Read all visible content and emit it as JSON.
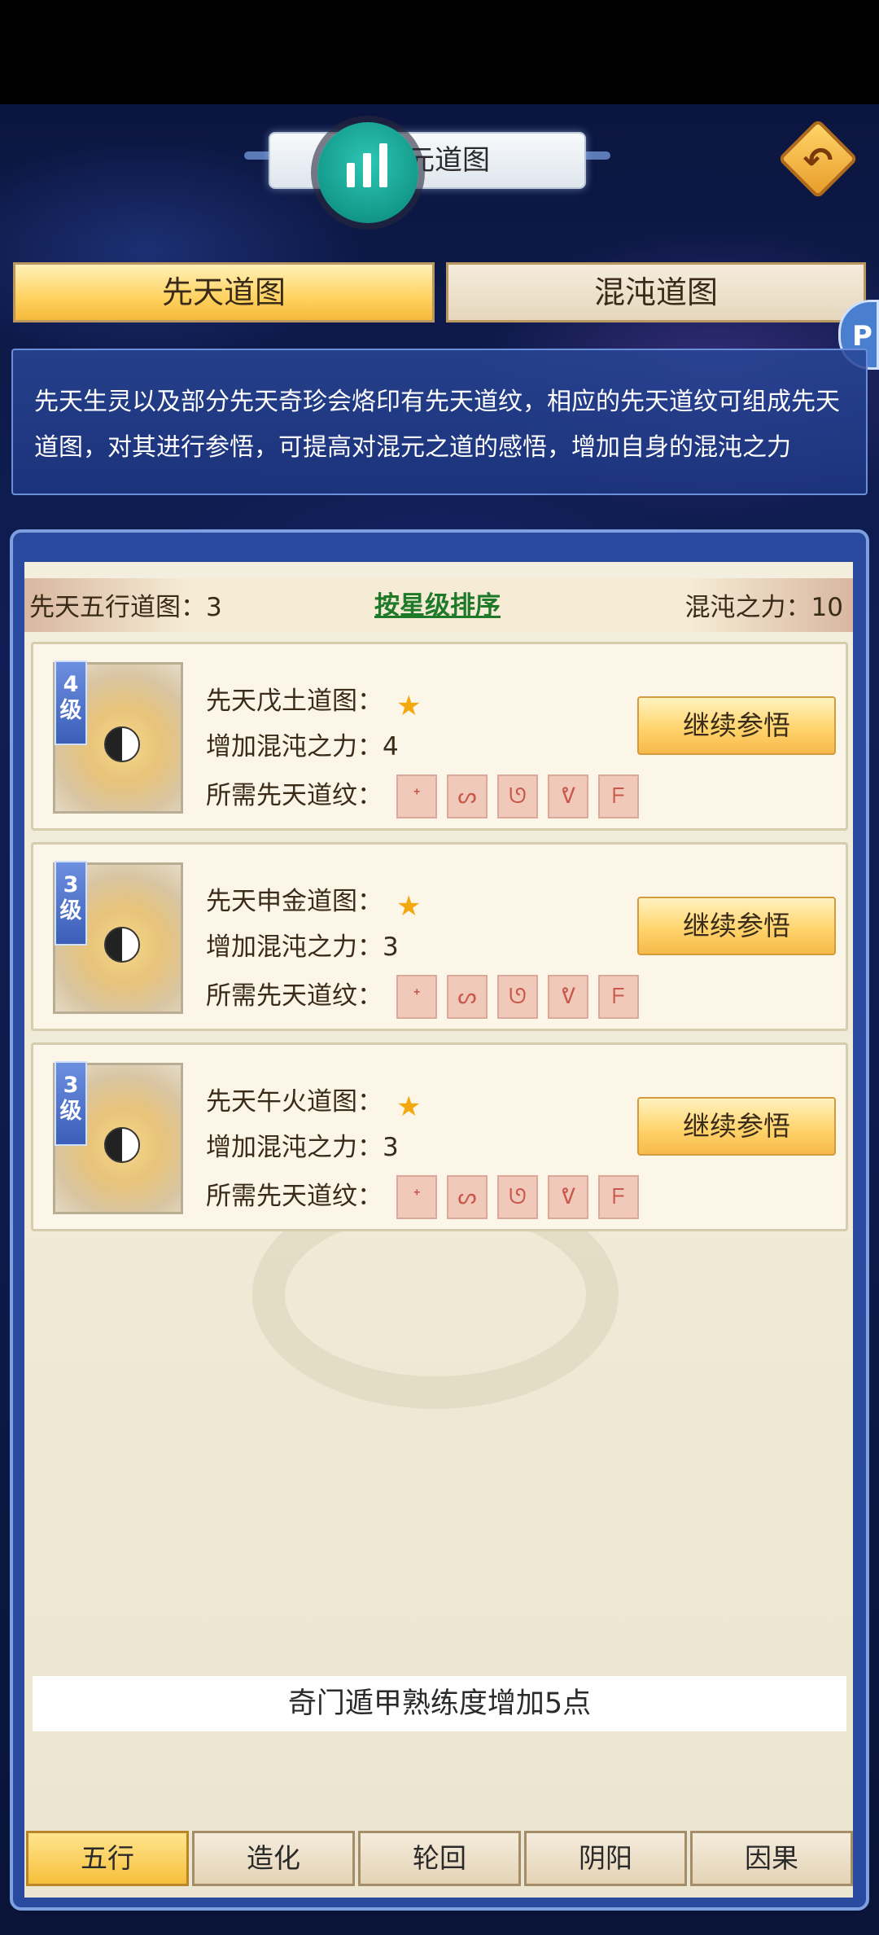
{
  "header": {
    "title_partial": "元道图"
  },
  "main_tabs": [
    {
      "label": "先天道图",
      "active": true
    },
    {
      "label": "混沌道图",
      "active": false
    }
  ],
  "side_float_glyph": "P",
  "description": "先天生灵以及部分先天奇珍会烙印有先天道纹，相应的先天道纹可组成先天道图，对其进行参悟，可提高对混元之道的感悟，增加自身的混沌之力",
  "info": {
    "count_label": "先天五行道图：3",
    "sort_label": "按星级排序",
    "power_label": "混沌之力：10"
  },
  "cards": [
    {
      "level_num": "4",
      "level_unit": "级",
      "name": "先天戊土道图：",
      "stars": 1,
      "power": "增加混沌之力：4",
      "req_label": "所需先天道纹：",
      "button": "继续参悟"
    },
    {
      "level_num": "3",
      "level_unit": "级",
      "name": "先天申金道图：",
      "stars": 1,
      "power": "增加混沌之力：3",
      "req_label": "所需先天道纹：",
      "button": "继续参悟"
    },
    {
      "level_num": "3",
      "level_unit": "级",
      "name": "先天午火道图：",
      "stars": 1,
      "power": "增加混沌之力：3",
      "req_label": "所需先天道纹：",
      "button": "继续参悟"
    }
  ],
  "icons": {
    "back": "undo-arrow-icon",
    "stats": "bar-chart-icon",
    "star": "star-icon",
    "glyph": "rune-icon"
  },
  "notice": "奇门遁甲熟练度增加5点",
  "bottom_tabs": [
    {
      "label": "五行",
      "active": true
    },
    {
      "label": "造化",
      "active": false
    },
    {
      "label": "轮回",
      "active": false
    },
    {
      "label": "阴阳",
      "active": false
    },
    {
      "label": "因果",
      "active": false
    }
  ],
  "colors": {
    "accent_gold": "#ffd260",
    "sort_link": "#1e7a28",
    "star": "#f3a80f",
    "panel_bg": "#f3eedd"
  }
}
